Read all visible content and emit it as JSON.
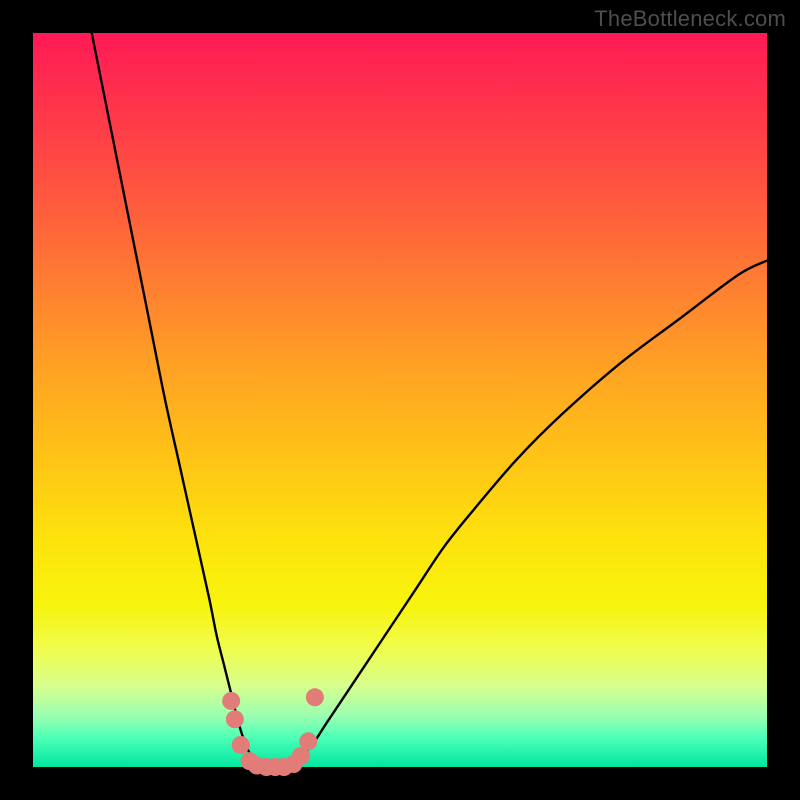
{
  "watermark": "TheBottleneck.com",
  "colors": {
    "frame": "#000000",
    "curve_stroke": "#000000",
    "marker_fill": "#e17c79",
    "gradient_top": "#ff1a55",
    "gradient_bottom": "#00e7a0"
  },
  "chart_data": {
    "type": "line",
    "title": "",
    "xlabel": "",
    "ylabel": "",
    "xlim": [
      0,
      100
    ],
    "ylim": [
      0,
      100
    ],
    "annotations": [
      "TheBottleneck.com"
    ],
    "series": [
      {
        "name": "bottleneck-curve",
        "x": [
          8,
          10,
          12,
          14,
          16,
          18,
          20,
          22,
          24,
          25,
          26,
          27,
          28,
          29,
          30,
          31,
          32,
          33,
          34,
          35,
          36,
          38,
          40,
          44,
          48,
          52,
          56,
          60,
          66,
          72,
          80,
          88,
          96,
          100
        ],
        "y": [
          100,
          90,
          80,
          70,
          60,
          50,
          41,
          32,
          23,
          18,
          14,
          10,
          6,
          3,
          1,
          0,
          0,
          0,
          0,
          0,
          1,
          3,
          6,
          12,
          18,
          24,
          30,
          35,
          42,
          48,
          55,
          61,
          67,
          69
        ]
      }
    ],
    "markers": {
      "name": "highlight-points",
      "x": [
        27.0,
        27.5,
        28.3,
        29.5,
        30.5,
        31.8,
        33.0,
        34.2,
        35.5,
        36.5,
        37.5,
        38.4
      ],
      "y": [
        9.0,
        6.5,
        3.0,
        0.8,
        0.2,
        0.0,
        0.0,
        0.0,
        0.4,
        1.5,
        3.5,
        9.5
      ]
    }
  }
}
